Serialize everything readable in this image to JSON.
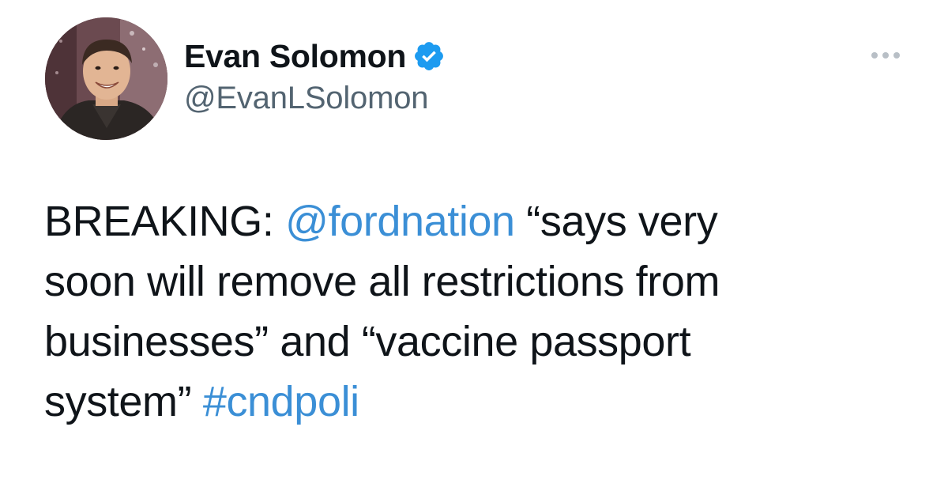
{
  "author": {
    "display_name": "Evan Solomon",
    "handle": "@EvanLSolomon",
    "verified": true,
    "avatar_icon": "profile-photo"
  },
  "tweet": {
    "line1_prefix": "BREAKING: ",
    "mention": "@fordnation",
    "line1_suffix": " “says very",
    "line2": "soon will remove all restrictions from",
    "line3": "businesses” and “vaccine passport",
    "line4_prefix": "system” ",
    "hashtag": "#cndpoli"
  },
  "actions": {
    "more_icon": "more-horizontal-icon"
  },
  "colors": {
    "link": "#3b8fd6",
    "verified_badge": "#1d9bf0",
    "text_primary": "#0f1419",
    "text_secondary": "#536471",
    "more_dots": "#b8bfc6"
  }
}
